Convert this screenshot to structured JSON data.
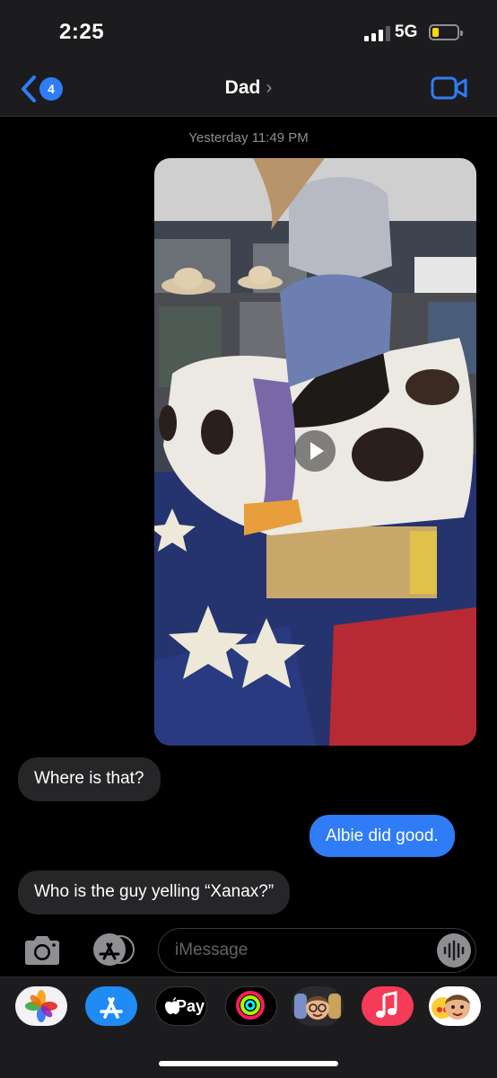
{
  "status_bar": {
    "time": "2:25",
    "network": "5G"
  },
  "nav": {
    "back_count": "4",
    "contact_name": "Dad",
    "contact_chevron": "›"
  },
  "thread": {
    "timestamp": "Yesterday 11:49 PM",
    "messages": [
      {
        "direction": "received",
        "text": "Where is that?"
      },
      {
        "direction": "sent",
        "text": "Albie did good."
      },
      {
        "direction": "received",
        "text": "Who is the guy yelling “Xanax?”"
      }
    ]
  },
  "composer": {
    "placeholder": "iMessage"
  },
  "app_drawer": {
    "apps": [
      "photos-icon",
      "app-store-icon",
      "apple-pay-icon",
      "activity-icon",
      "memoji-icon",
      "music-icon",
      "memoji-stickers-icon"
    ],
    "apple_pay_label": "Pay"
  },
  "colors": {
    "accent": "#2f7cf6",
    "received_bubble": "#262629",
    "background": "#000000",
    "bar": "#1c1c1e"
  }
}
